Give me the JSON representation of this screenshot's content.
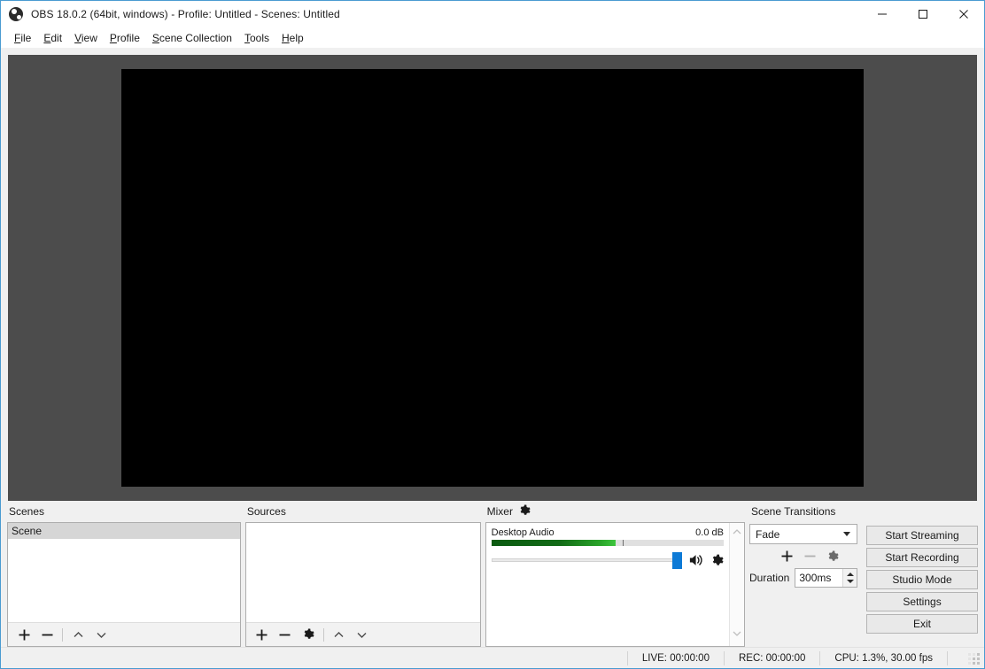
{
  "window": {
    "title": "OBS 18.0.2 (64bit, windows) - Profile: Untitled - Scenes: Untitled",
    "app_icon": "obs-logo-icon",
    "minimize_label": "Minimize",
    "maximize_label": "Maximize",
    "close_label": "Close"
  },
  "menubar": {
    "items": [
      {
        "label": "File",
        "mnemonic": "F",
        "rest": "ile"
      },
      {
        "label": "Edit",
        "mnemonic": "E",
        "rest": "dit"
      },
      {
        "label": "View",
        "mnemonic": "V",
        "rest": "iew"
      },
      {
        "label": "Profile",
        "mnemonic": "P",
        "rest": "rofile"
      },
      {
        "label": "Scene Collection",
        "mnemonic": "S",
        "rest": "cene Collection"
      },
      {
        "label": "Tools",
        "mnemonic": "T",
        "rest": "ools"
      },
      {
        "label": "Help",
        "mnemonic": "H",
        "rest": "elp"
      }
    ]
  },
  "preview": {
    "background_color": "#4c4c4c",
    "canvas_color": "#000000"
  },
  "scenes": {
    "title": "Scenes",
    "items": [
      {
        "label": "Scene",
        "selected": true
      }
    ],
    "toolbar": {
      "add_label": "+",
      "remove_label": "—",
      "move_up_label": "Move scene up",
      "move_down_label": "Move scene down"
    }
  },
  "sources": {
    "title": "Sources",
    "items": [],
    "toolbar": {
      "add_label": "+",
      "remove_label": "—",
      "properties_label": "Properties",
      "move_up_label": "Move source up",
      "move_down_label": "Move source down"
    }
  },
  "mixer": {
    "title": "Mixer",
    "settings_icon": "gear-icon",
    "channels": [
      {
        "name": "Desktop Audio",
        "level_db": "0.0 dB",
        "meter_percent": 53.5,
        "meter_tick_percent": 56.5,
        "volume_percent": 100,
        "muted": false,
        "mute_icon": "speaker-icon",
        "settings_icon": "gear-icon"
      }
    ],
    "scrollbar": {
      "up_label": "Scroll up",
      "down_label": "Scroll down"
    }
  },
  "transitions": {
    "title": "Scene Transitions",
    "selected": "Fade",
    "options": [
      "Fade"
    ],
    "add_label": "+",
    "remove_label": "—",
    "properties_label": "Transition properties",
    "duration_label": "Duration",
    "duration_value": "300ms",
    "remove_disabled": true
  },
  "controls": {
    "buttons": [
      {
        "label": "Start Streaming"
      },
      {
        "label": "Start Recording"
      },
      {
        "label": "Studio Mode"
      },
      {
        "label": "Settings"
      },
      {
        "label": "Exit"
      }
    ]
  },
  "statusbar": {
    "live": "LIVE: 00:00:00",
    "rec": "REC: 00:00:00",
    "cpu": "CPU: 1.3%, 30.00 fps"
  },
  "colors": {
    "accent": "#0d7ad6",
    "window_border": "#4a9bd1",
    "meter_green": "#2aa52a",
    "chrome": "#f0f0f0",
    "selection": "#d6d6d6"
  }
}
